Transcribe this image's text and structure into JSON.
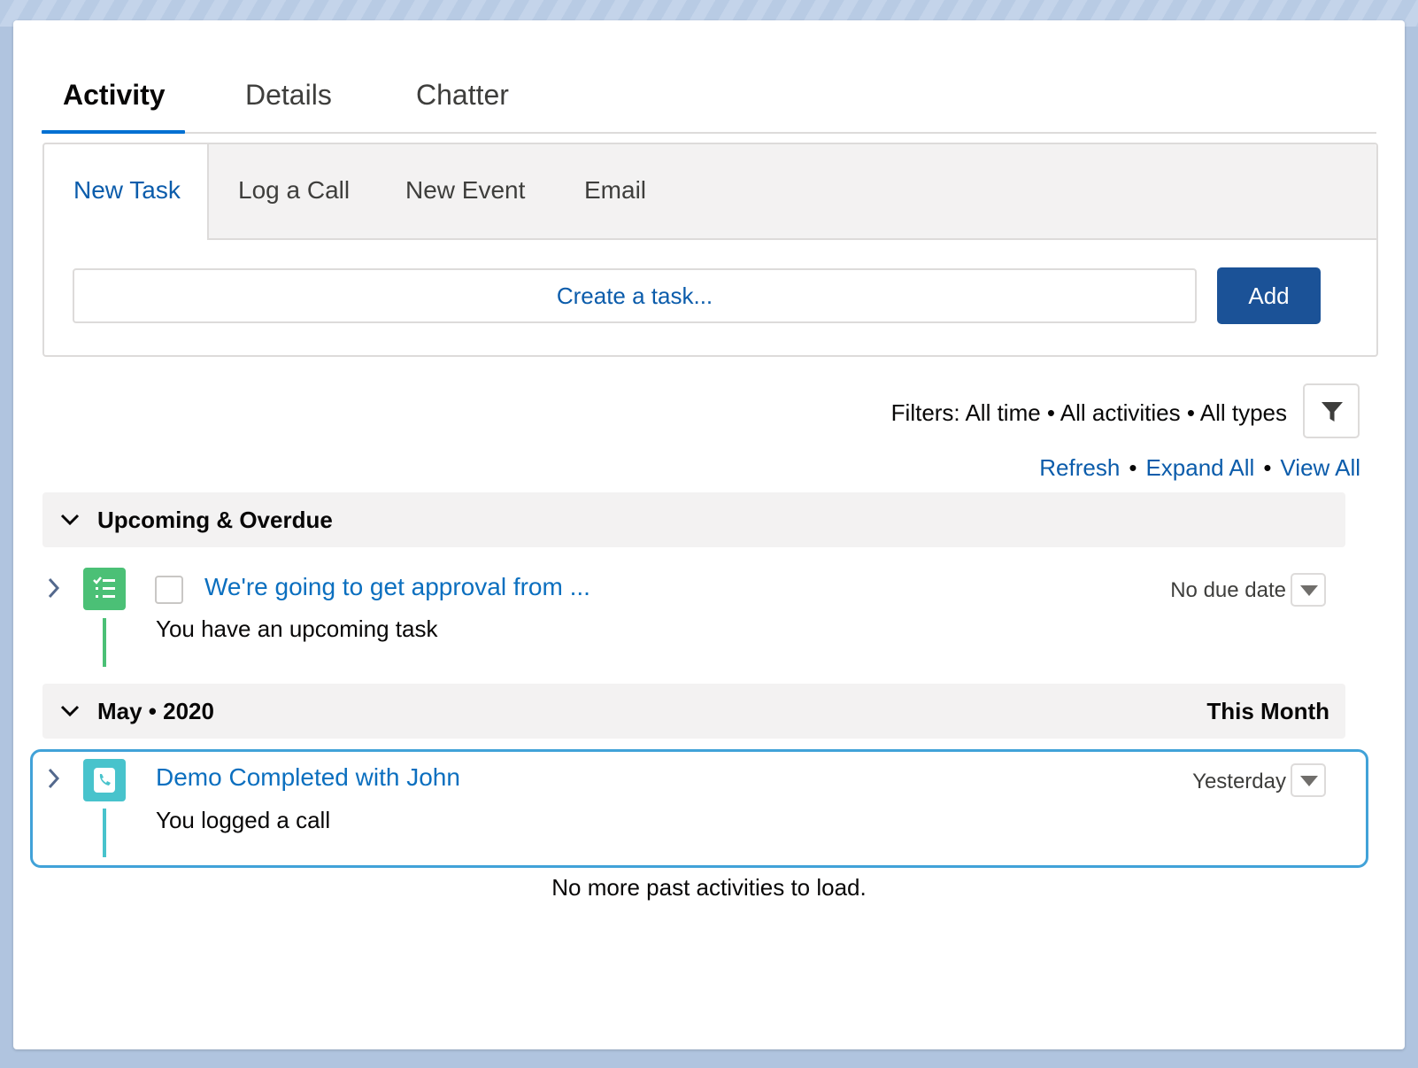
{
  "top_tabs": {
    "activity": "Activity",
    "details": "Details",
    "chatter": "Chatter"
  },
  "composer": {
    "tabs": {
      "new_task": "New Task",
      "log_call": "Log a Call",
      "new_event": "New Event",
      "email": "Email"
    },
    "task_placeholder": "Create a task...",
    "add_label": "Add"
  },
  "filters": {
    "text": "Filters: All time • All activities • All types",
    "links": {
      "refresh": "Refresh",
      "expand_all": "Expand All",
      "view_all": "View All",
      "separator": "•"
    }
  },
  "upcoming": {
    "title": "Upcoming & Overdue",
    "item": {
      "title": "We're going to get approval from ...",
      "subtitle": "You have an upcoming task",
      "date": "No due date"
    }
  },
  "month": {
    "title": "May • 2020",
    "right_label": "This Month",
    "item": {
      "title": "Demo Completed with John",
      "subtitle": "You logged a call",
      "date": "Yesterday"
    }
  },
  "footer": {
    "no_more": "No more past activities to load."
  },
  "colors": {
    "accent": "#0070d2",
    "link": "#0b5cab",
    "button": "#1b5297",
    "task_icon": "#4bc076",
    "call_icon": "#48c3cc",
    "focus": "#41a2d8"
  },
  "icons": {
    "filter": "filter-icon",
    "task": "task-icon",
    "call": "log-call-icon",
    "chevron_down": "chevron-down-icon",
    "chevron_right": "chevron-right-icon",
    "menu": "dropdown-triangle-icon"
  }
}
